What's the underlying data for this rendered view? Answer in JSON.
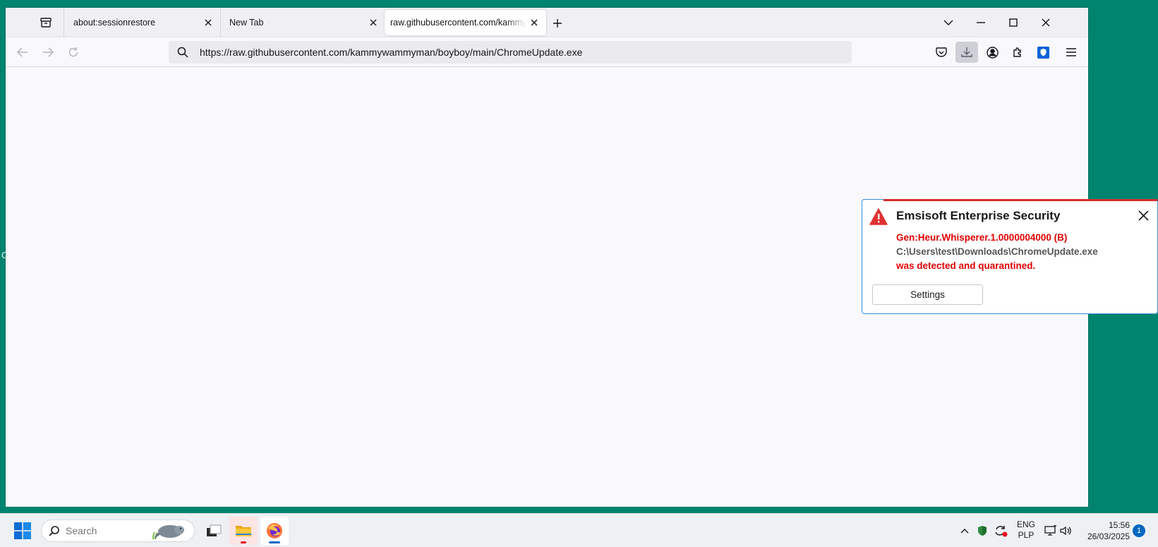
{
  "desktop": {
    "edge_glyph": "C"
  },
  "browser": {
    "tabs": [
      {
        "title": "about:sessionrestore",
        "active": false
      },
      {
        "title": "New Tab",
        "active": false
      },
      {
        "title": "raw.githubusercontent.com/kammywammyman/boyboy/main/ChromeUpdate.exe",
        "active": true
      }
    ],
    "url": "https://raw.githubusercontent.com/kammywammyman/boyboy/main/ChromeUpdate.exe",
    "icons": {
      "tab_overview": "firefox-view-icon",
      "new_tab": "plus-icon",
      "list_tabs": "chevron-down-icon",
      "back": "back-arrow-icon",
      "forward": "forward-arrow-icon",
      "reload": "reload-icon",
      "pocket": "pocket-icon",
      "downloads": "download-icon",
      "account": "account-icon",
      "extensions": "puzzle-icon",
      "shield_extension": "shield-icon",
      "menu": "hamburger-icon"
    }
  },
  "toast": {
    "title": "Emsisoft Enterprise Security",
    "threat": "Gen:Heur.Whisperer.1.0000004000 (B)",
    "path": "C:\\Users\\test\\Downloads\\ChromeUpdate.exe",
    "status": "was detected and quarantined.",
    "settings_label": "Settings",
    "colors": {
      "alert": "#e00000",
      "border": "#3b8ed6"
    }
  },
  "taskbar": {
    "search_placeholder": "Search",
    "language": "ENG",
    "layout": "PLP",
    "time": "15:56",
    "date": "26/03/2025",
    "notification_count": "1"
  }
}
